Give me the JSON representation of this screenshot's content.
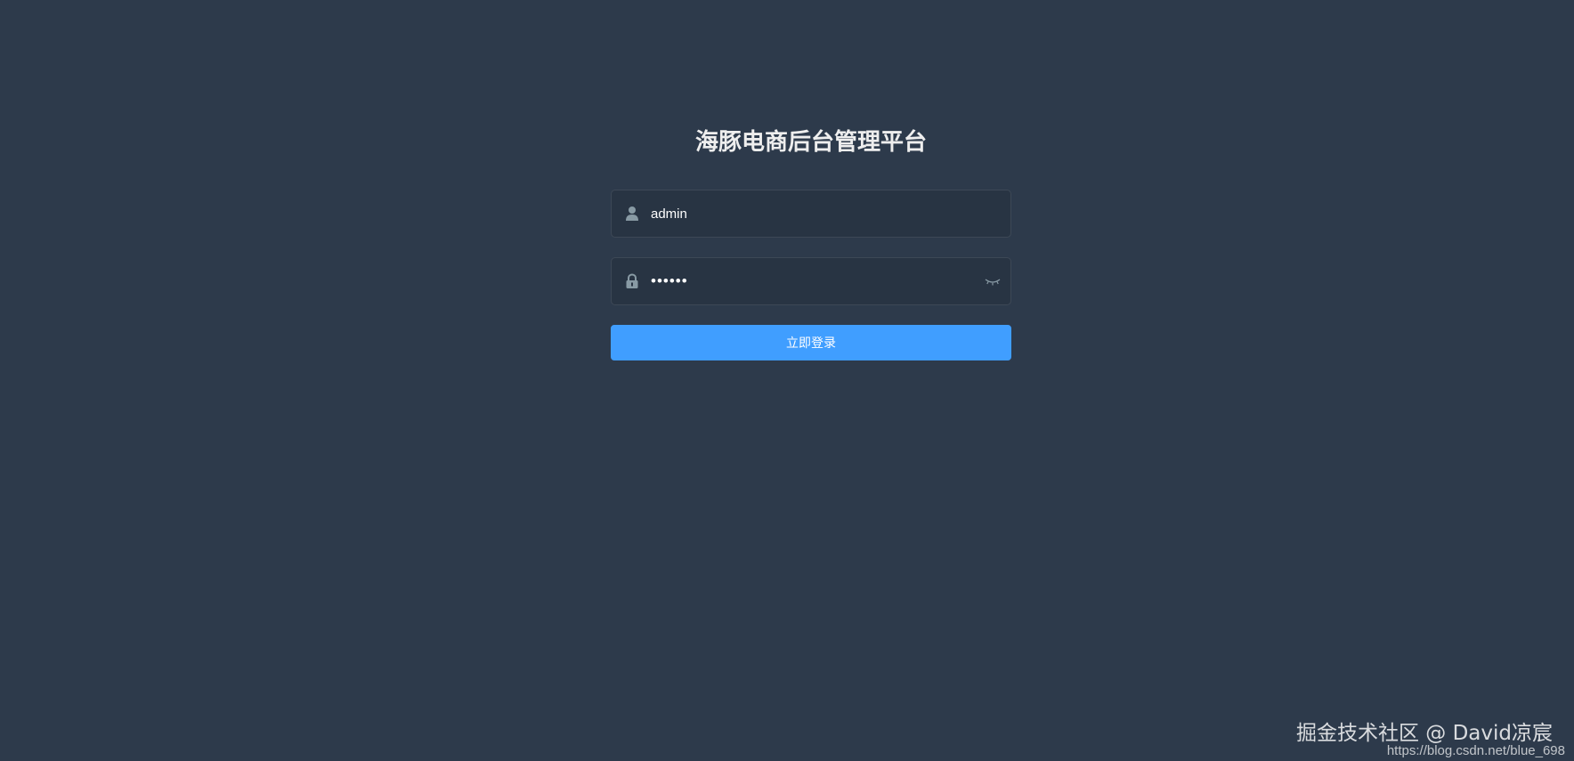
{
  "login": {
    "title": "海豚电商后台管理平台",
    "username": {
      "value": "admin",
      "icon": "user-icon"
    },
    "password": {
      "value": "••••••",
      "icon": "lock-icon",
      "toggle_icon": "eye-closed-icon"
    },
    "submit_label": "立即登录"
  },
  "colors": {
    "background": "#2d3a4b",
    "input_background": "#283443",
    "button": "#409eff",
    "title": "#eeeeee"
  },
  "watermark": {
    "text": "掘金技术社区 @ David凉宸",
    "url": "https://blog.csdn.net/blue_698"
  }
}
